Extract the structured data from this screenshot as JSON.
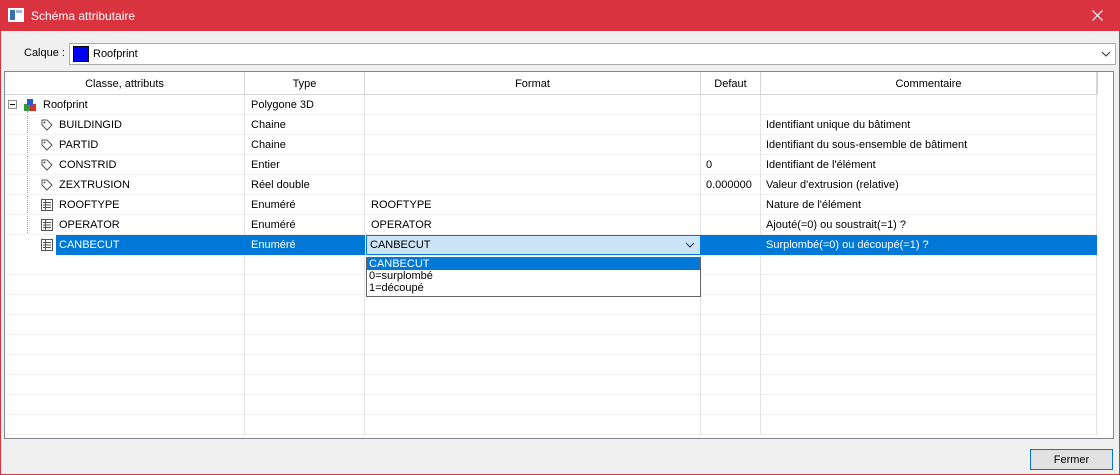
{
  "window": {
    "title": "Schéma attributaire",
    "accent": "#d9333f"
  },
  "calque": {
    "label": "Calque :",
    "value": "Roofprint",
    "swatch_color": "#0000ff"
  },
  "columns": [
    "Classe, attributs",
    "Type",
    "Format",
    "Defaut",
    "Commentaire"
  ],
  "rows": [
    {
      "name": "Roofprint",
      "type": "Polygone 3D",
      "format": "",
      "defaut": "",
      "commentaire": "",
      "icon": "layer-class-icon",
      "level": 0
    },
    {
      "name": "BUILDINGID",
      "type": "Chaine",
      "format": "",
      "defaut": "",
      "commentaire": "Identifiant unique du bâtiment",
      "icon": "tag-icon",
      "level": 1
    },
    {
      "name": "PARTID",
      "type": "Chaine",
      "format": "",
      "defaut": "",
      "commentaire": "Identifiant du sous-ensemble de bâtiment",
      "icon": "tag-icon",
      "level": 1
    },
    {
      "name": "CONSTRID",
      "type": "Entier",
      "format": "",
      "defaut": "0",
      "commentaire": "Identifiant de l'élément",
      "icon": "tag-icon",
      "level": 1
    },
    {
      "name": "ZEXTRUSION",
      "type": "Réel double",
      "format": "",
      "defaut": "0.000000",
      "commentaire": "Valeur d'extrusion (relative)",
      "icon": "tag-icon",
      "level": 1
    },
    {
      "name": "ROOFTYPE",
      "type": "Enuméré",
      "format": "ROOFTYPE",
      "defaut": "",
      "commentaire": "Nature de l'élément",
      "icon": "enum-icon",
      "level": 1
    },
    {
      "name": "OPERATOR",
      "type": "Enuméré",
      "format": "OPERATOR",
      "defaut": "",
      "commentaire": "Ajouté(=0) ou soustrait(=1) ?",
      "icon": "enum-icon",
      "level": 1
    },
    {
      "name": "CANBECUT",
      "type": "Enuméré",
      "format": "CANBECUT",
      "defaut": "",
      "commentaire": "Surplombé(=0) ou découpé(=1) ?",
      "icon": "enum-icon",
      "level": 1,
      "selected": true
    }
  ],
  "format_dropdown": {
    "value": "CANBECUT",
    "options": [
      "CANBECUT",
      "0=surplombé",
      "1=découpé"
    ],
    "highlighted": "CANBECUT"
  },
  "buttons": {
    "close": "Fermer"
  },
  "colors": {
    "selection": "#0078d7",
    "dropdown_edit": "#cce4f7"
  }
}
